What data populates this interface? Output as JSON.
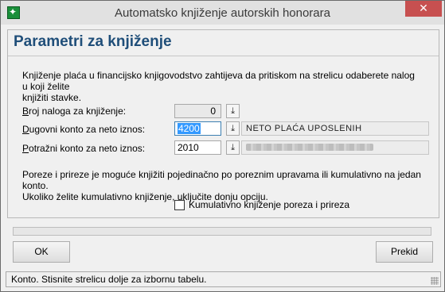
{
  "window": {
    "title": "Automatsko knjiženje autorskih honorara",
    "close_glyph": "✕"
  },
  "panel": {
    "heading": "Parametri za knjiženje",
    "intro_line1": "Knjiženje plaća u financijsko knjigovodstvo zahtijeva da pritiskom na strelicu odaberete nalog u koji želite",
    "intro_line2": "knjižiti stavke."
  },
  "fields": {
    "broj_naloga": {
      "label_first": "B",
      "label_rest": "roj naloga za knjiženje:",
      "value": "0"
    },
    "dugovni": {
      "label_first": "D",
      "label_rest": "ugovni konto za neto iznos:",
      "value": "4200",
      "description": "NETO PLAĆA UPOSLENIH"
    },
    "potrazni": {
      "label_first": "P",
      "label_rest": "otražni konto za neto iznos:",
      "value": "2010"
    }
  },
  "info": {
    "line1": "Poreze i prireze je moguće knjižiti pojedinačno po poreznim upravama ili kumulativno na jedan konto.",
    "line2": "Ukoliko želite kumulativno knjiženje, uključite donju opciju."
  },
  "checkbox": {
    "label": "Kumulativno knjiženje poreza i prireza",
    "checked": false
  },
  "progress": {
    "value": 0
  },
  "buttons": {
    "ok": "OK",
    "cancel": "Prekid"
  },
  "status_bar": {
    "text": "Konto. Stisnite strelicu dolje za izbornu tabelu."
  },
  "icons": {
    "picker_glyph": "⤓",
    "app": "app-logo-icon"
  }
}
